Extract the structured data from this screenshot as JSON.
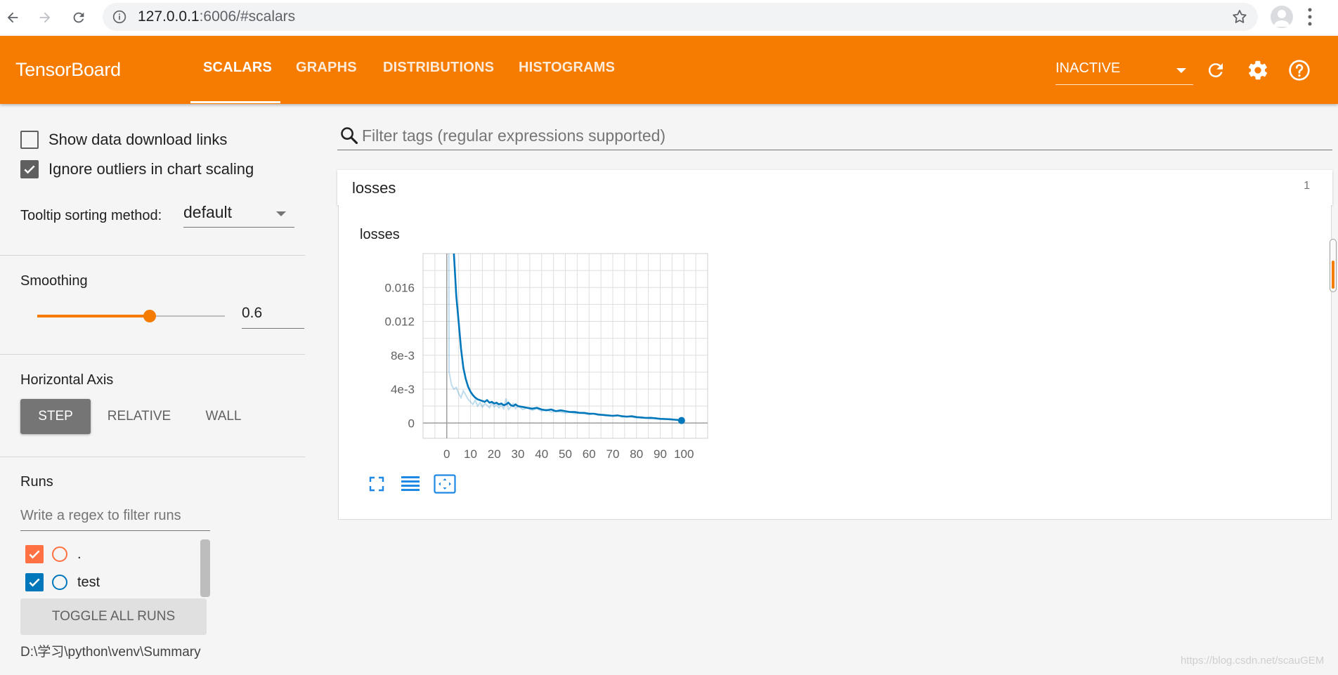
{
  "browser": {
    "url_host": "127.0.0.1",
    "url_path": ":6006/#scalars",
    "icons": [
      "back-arrow-icon",
      "forward-arrow-icon",
      "reload-icon",
      "info-icon",
      "star-icon",
      "profile-icon",
      "kebab-menu-icon"
    ]
  },
  "header": {
    "title": "TensorBoard",
    "tabs": [
      {
        "label": "SCALARS",
        "active": true
      },
      {
        "label": "GRAPHS",
        "active": false
      },
      {
        "label": "DISTRIBUTIONS",
        "active": false
      },
      {
        "label": "HISTOGRAMS",
        "active": false
      }
    ],
    "inactive_select": "INACTIVE",
    "accent": "#f57c00",
    "icons": [
      "refresh-icon",
      "settings-icon",
      "help-icon"
    ]
  },
  "sidebar": {
    "show_download_links": {
      "label": "Show data download links",
      "checked": false
    },
    "ignore_outliers": {
      "label": "Ignore outliers in chart scaling",
      "checked": true
    },
    "tooltip_sorting": {
      "label": "Tooltip sorting method:",
      "value": "default"
    },
    "smoothing": {
      "label": "Smoothing",
      "value": "0.6",
      "level": 0.6
    },
    "horizontal_axis": {
      "label": "Horizontal Axis",
      "options": [
        {
          "label": "STEP",
          "active": true
        },
        {
          "label": "RELATIVE",
          "active": false
        },
        {
          "label": "WALL",
          "active": false
        }
      ]
    },
    "runs": {
      "label": "Runs",
      "filter_placeholder": "Write a regex to filter runs",
      "items": [
        {
          "name": ".",
          "color": "#ff7043",
          "checked": true
        },
        {
          "name": "test",
          "color": "#0077bb",
          "checked": true
        }
      ],
      "toggle_label": "TOGGLE ALL RUNS",
      "logdir": "D:\\学习\\python\\venv\\Summary"
    }
  },
  "main": {
    "filter_placeholder": "Filter tags (regular expressions supported)",
    "category": {
      "name": "losses",
      "count": "1"
    },
    "card_title": "losses",
    "tool_icons": [
      "fullscreen-icon",
      "toggle-log-scale-icon",
      "fit-domain-icon"
    ]
  },
  "watermark": "https://blog.csdn.net/scauGEM",
  "chart_data": {
    "type": "line",
    "title": "losses",
    "xlabel": "",
    "ylabel": "",
    "xlim": [
      -10,
      110
    ],
    "ylim": [
      -0.0018,
      0.02
    ],
    "x_ticks": [
      0,
      10,
      20,
      30,
      40,
      50,
      60,
      70,
      80,
      90,
      100
    ],
    "y_ticks": [
      0,
      0.004,
      0.008,
      0.012,
      0.016
    ],
    "y_tick_labels": [
      "0",
      "4e-3",
      "8e-3",
      "0.012",
      "0.016"
    ],
    "grid": true,
    "series": [
      {
        "color": "#0077bb",
        "raw_opacity": 0.25,
        "x": [
          1,
          2,
          3,
          4,
          5,
          6,
          7,
          8,
          9,
          10,
          11,
          12,
          13,
          14,
          15,
          16,
          17,
          18,
          19,
          20,
          21,
          22,
          23,
          24,
          25,
          26,
          27,
          28,
          29,
          30,
          32,
          34,
          36,
          38,
          40,
          42,
          44,
          46,
          48,
          50,
          52,
          54,
          56,
          58,
          60,
          62,
          64,
          66,
          68,
          70,
          72,
          74,
          76,
          78,
          80,
          82,
          84,
          86,
          88,
          90,
          92,
          94,
          96,
          98,
          99
        ],
        "y_smoothed": [
          0.05,
          0.035,
          0.02,
          0.015,
          0.012,
          0.0088,
          0.0065,
          0.0052,
          0.0043,
          0.0037,
          0.0033,
          0.003,
          0.0028,
          0.0027,
          0.0026,
          0.0025,
          0.0027,
          0.0024,
          0.0025,
          0.0023,
          0.0024,
          0.0022,
          0.0023,
          0.0021,
          0.0022,
          0.0024,
          0.0021,
          0.002,
          0.0022,
          0.002,
          0.0019,
          0.0018,
          0.0017,
          0.0018,
          0.0016,
          0.0015,
          0.0016,
          0.0014,
          0.0015,
          0.0014,
          0.0013,
          0.0013,
          0.0012,
          0.0012,
          0.0011,
          0.0011,
          0.001,
          0.00095,
          0.0009,
          0.00085,
          0.0009,
          0.0008,
          0.00075,
          0.0008,
          0.0007,
          0.00065,
          0.0006,
          0.00062,
          0.00055,
          0.0005,
          0.00048,
          0.00045,
          0.0004,
          0.00035,
          0.0003
        ],
        "y_raw": [
          0.006,
          0.0045,
          0.004,
          0.0042,
          0.0035,
          0.003,
          0.0038,
          0.0033,
          0.0028,
          0.0025,
          0.0022,
          0.0027,
          0.002,
          0.0024,
          0.0019,
          0.0023,
          0.0021,
          0.0018,
          0.0024,
          0.0019,
          0.0022,
          0.0018,
          0.0021,
          0.0017,
          0.0029,
          0.0016,
          0.0019,
          0.0023,
          0.0017,
          0.002,
          0.0016,
          0.0018,
          0.0015,
          0.0017,
          0.0014,
          0.0016,
          0.0013,
          0.0014,
          0.0013,
          0.0012,
          0.0013,
          0.0011,
          0.0012,
          0.0011,
          0.001,
          0.0011,
          0.0009,
          0.001,
          0.0009,
          0.0008,
          0.0009,
          0.0007,
          0.0008,
          0.0007,
          0.0006,
          0.0007,
          0.0006,
          0.0005,
          0.0006,
          0.0005,
          0.0004,
          0.0005,
          0.0004,
          0.0003,
          0.0003
        ]
      }
    ]
  }
}
